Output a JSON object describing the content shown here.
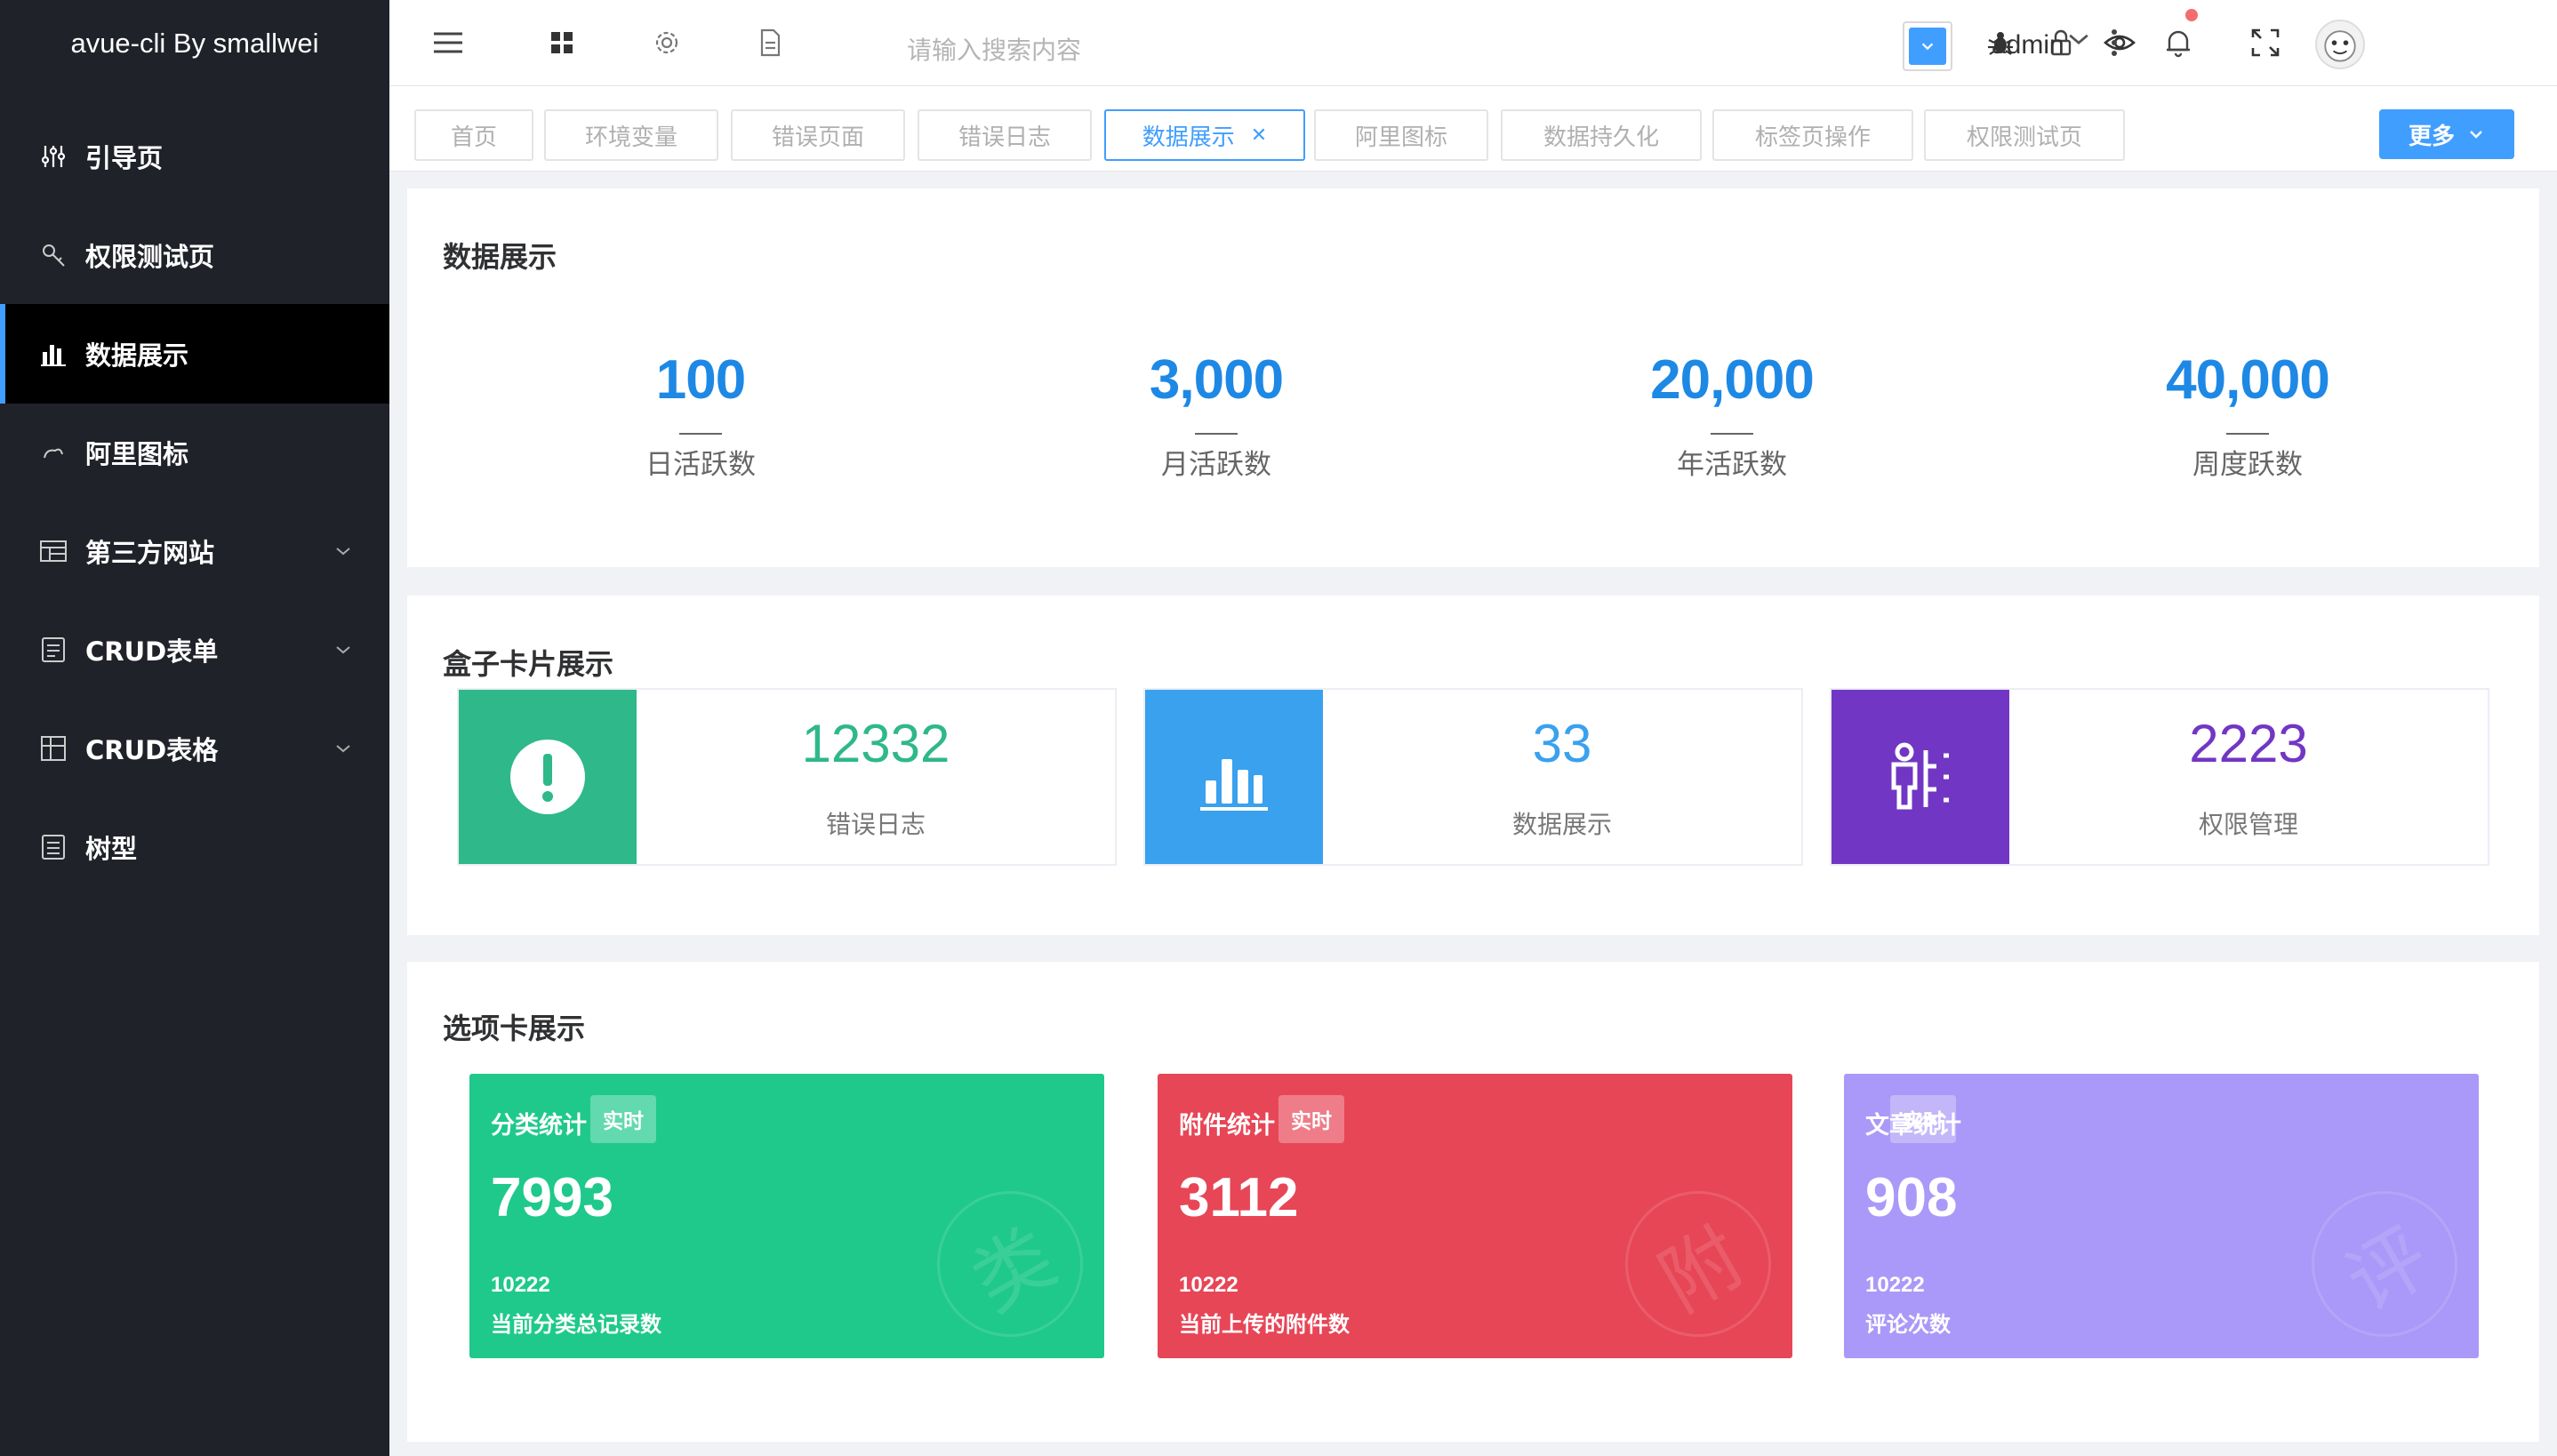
{
  "app": {
    "logo_text": "avue-cli By smallwei"
  },
  "sidebar": {
    "items": [
      {
        "label": "引导页",
        "icon": "guide-icon"
      },
      {
        "label": "权限测试页",
        "icon": "key-icon"
      },
      {
        "label": "数据展示",
        "icon": "bar-chart-icon",
        "active": true
      },
      {
        "label": "阿里图标",
        "icon": "cloud-icon"
      },
      {
        "label": "第三方网站",
        "icon": "table-icon",
        "has_children": true
      },
      {
        "label": "CRUD表单",
        "icon": "form-icon",
        "has_children": true
      },
      {
        "label": "CRUD表格",
        "icon": "grid-icon",
        "has_children": true
      },
      {
        "label": "树型",
        "icon": "tree-icon"
      }
    ]
  },
  "header": {
    "search_placeholder": "请输入搜索内容",
    "username": "admin",
    "icons": [
      "menu-toggle-icon",
      "apps-grid-icon",
      "settings-icon",
      "document-icon",
      "theme-dropdown-icon",
      "bug-icon",
      "lock-icon",
      "eye-icon",
      "bell-icon",
      "fullscreen-icon",
      "more-vertical-icon"
    ]
  },
  "tabs": {
    "items": [
      "首页",
      "环境变量",
      "错误页面",
      "错误日志",
      "数据展示",
      "阿里图标",
      "数据持久化",
      "标签页操作",
      "权限测试页"
    ],
    "active_index": 4,
    "more_label": "更多"
  },
  "section_data": {
    "title": "数据展示",
    "stats": [
      {
        "value": "100",
        "label": "日活跃数"
      },
      {
        "value": "3,000",
        "label": "月活跃数"
      },
      {
        "value": "20,000",
        "label": "年活跃数"
      },
      {
        "value": "40,000",
        "label": "周度跃数"
      }
    ]
  },
  "section_box": {
    "title": "盒子卡片展示",
    "boxes": [
      {
        "value": "12332",
        "label": "错误日志",
        "color": "#2fb889",
        "icon": "alert-icon"
      },
      {
        "value": "33",
        "label": "数据展示",
        "color": "#3aa1ee",
        "icon": "bar-chart-icon"
      },
      {
        "value": "2223",
        "label": "权限管理",
        "color": "#7236c4",
        "icon": "person-icon"
      }
    ]
  },
  "section_tiles": {
    "title": "选项卡展示",
    "tiles": [
      {
        "title": "分类统计",
        "tag": "实时",
        "value": "7993",
        "sub": "10222",
        "desc": "当前分类总记录数",
        "watermark": "类",
        "color": "#1fc98b"
      },
      {
        "title": "附件统计",
        "tag": "实时",
        "value": "3112",
        "sub": "10222",
        "desc": "当前上传的附件数",
        "watermark": "附",
        "color": "#e74656"
      },
      {
        "title": "文章统计",
        "tag": "实时",
        "value": "908",
        "sub": "10222",
        "desc": "评论次数",
        "watermark": "评",
        "color": "#aa99f8"
      }
    ]
  },
  "colors": {
    "accent": "#409eff",
    "sidebar": "#20222a",
    "stat_number": "#1e88e5"
  }
}
